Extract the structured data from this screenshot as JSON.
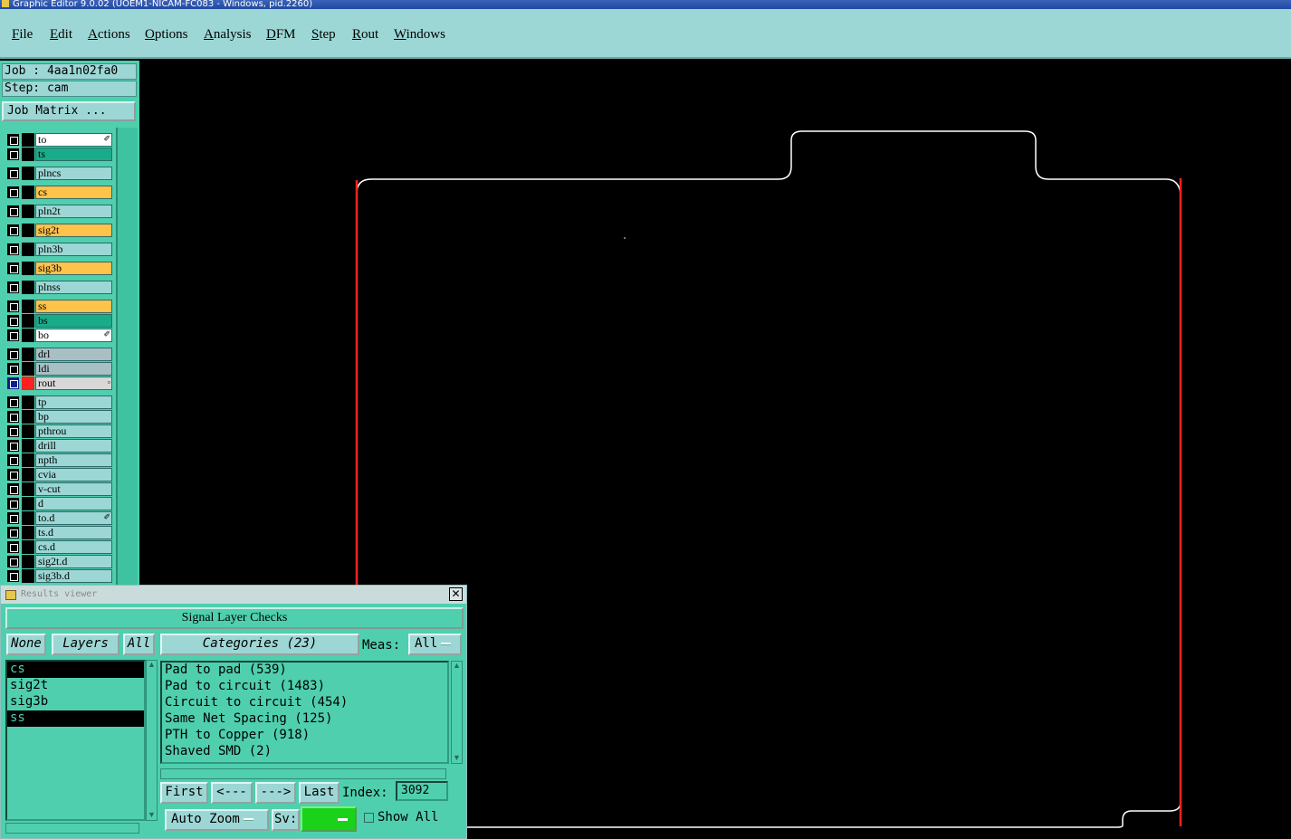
{
  "window": {
    "title": "Graphic Editor 9.0.02 (UOEM1-NICAM-FC083 - Windows, pid.2260)"
  },
  "menu": [
    "File",
    "Edit",
    "Actions",
    "Options",
    "Analysis",
    "DFM",
    "Step",
    "Rout",
    "Windows"
  ],
  "job": {
    "job_label": "Job : 4aa1n02fa0",
    "step_label": "Step: cam",
    "matrix_button": "Job Matrix ..."
  },
  "layers": [
    {
      "name": "to",
      "bg": "#ffffff",
      "mark": "✐"
    },
    {
      "name": "ts",
      "bg": "#1aab88",
      "mark": ""
    },
    {
      "name": "plncs",
      "bg": "#9cd7d5",
      "mark": ""
    },
    {
      "name": "cs",
      "bg": "#ffc24a",
      "mark": ""
    },
    {
      "name": "pln2t",
      "bg": "#9cd7d5",
      "mark": ""
    },
    {
      "name": "sig2t",
      "bg": "#ffc24a",
      "mark": ""
    },
    {
      "name": "pln3b",
      "bg": "#9cd7d5",
      "mark": ""
    },
    {
      "name": "sig3b",
      "bg": "#ffc24a",
      "mark": ""
    },
    {
      "name": "plnss",
      "bg": "#9cd7d5",
      "mark": ""
    },
    {
      "name": "ss",
      "bg": "#ffc24a",
      "mark": ""
    },
    {
      "name": "bs",
      "bg": "#1aab88",
      "mark": ""
    },
    {
      "name": "bo",
      "bg": "#ffffff",
      "mark": "✐"
    },
    {
      "name": "drl",
      "bg": "#a8bfc4",
      "mark": ""
    },
    {
      "name": "ldi",
      "bg": "#a8bfc4",
      "mark": ""
    },
    {
      "name": "rout",
      "bg": "#d8d8d8",
      "mark": "▫"
    },
    {
      "name": "tp",
      "bg": "#9cd7d5",
      "mark": ""
    },
    {
      "name": "bp",
      "bg": "#9cd7d5",
      "mark": ""
    },
    {
      "name": "pthrou",
      "bg": "#9cd7d5",
      "mark": ""
    },
    {
      "name": "drill",
      "bg": "#9cd7d5",
      "mark": ""
    },
    {
      "name": "npth",
      "bg": "#9cd7d5",
      "mark": ""
    },
    {
      "name": "cvia",
      "bg": "#9cd7d5",
      "mark": ""
    },
    {
      "name": "v-cut",
      "bg": "#9cd7d5",
      "mark": ""
    },
    {
      "name": "d",
      "bg": "#9cd7d5",
      "mark": ""
    },
    {
      "name": "to.d",
      "bg": "#9cd7d5",
      "mark": "✐"
    },
    {
      "name": "ts.d",
      "bg": "#9cd7d5",
      "mark": ""
    },
    {
      "name": "cs.d",
      "bg": "#9cd7d5",
      "mark": ""
    },
    {
      "name": "sig2t.d",
      "bg": "#9cd7d5",
      "mark": ""
    },
    {
      "name": "sig3b.d",
      "bg": "#9cd7d5",
      "mark": ""
    }
  ],
  "results_viewer": {
    "title": "Results viewer",
    "header": "Signal Layer Checks",
    "none_btn": "None",
    "layers_btn": "Layers",
    "all_btn": "All",
    "layer_items": [
      {
        "name": "cs",
        "selected": true
      },
      {
        "name": "sig2t",
        "selected": false
      },
      {
        "name": "sig3b",
        "selected": false
      },
      {
        "name": "ss",
        "selected": true
      }
    ],
    "categories_btn": "Categories (23)",
    "meas_label": "Meas:",
    "meas_value": "All",
    "categories": [
      "Pad to pad (539)",
      "Pad to circuit (1483)",
      "Circuit to circuit (454)",
      "Same Net Spacing (125)",
      "PTH to Copper (918)",
      "Shaved SMD (2)"
    ],
    "first_btn": "First",
    "prev_btn": "<---",
    "next_btn": "--->",
    "last_btn": "Last",
    "index_label": "Index:",
    "index_value": "3092",
    "auto_zoom": "Auto Zoom",
    "sv_label": "Sv:",
    "show_all": "Show All"
  },
  "colors": {
    "outline": "#ffffff",
    "rout_edge": "#ff2020",
    "panel": "#4fcfae",
    "menu": "#9cd7d5"
  }
}
